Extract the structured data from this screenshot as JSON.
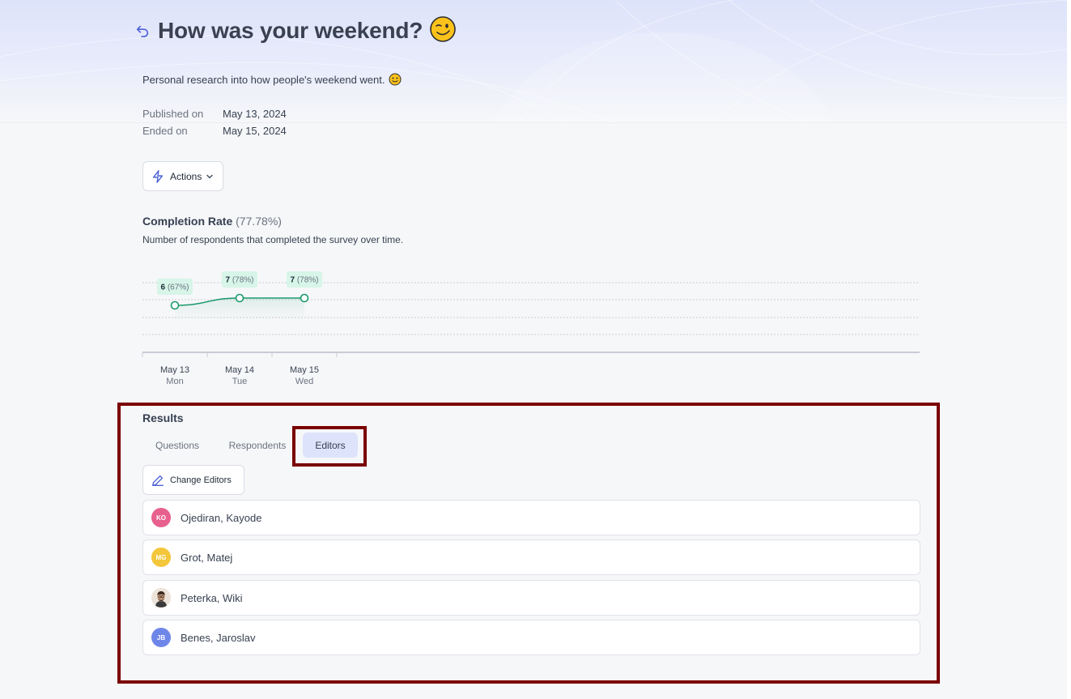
{
  "survey": {
    "title": "How was your weekend?",
    "description": "Personal research into how people's weekend went.",
    "published_label": "Published on",
    "published_value": "May 13, 2024",
    "ended_label": "Ended on",
    "ended_value": "May 15, 2024"
  },
  "actions": {
    "label": "Actions"
  },
  "completion": {
    "title": "Completion Rate",
    "rate": "(77.78%)",
    "subtitle": "Number of respondents that completed the survey over time."
  },
  "chart_data": {
    "type": "line",
    "categories": [
      "May 13",
      "May 14",
      "May 15"
    ],
    "weekdays": [
      "Mon",
      "Tue",
      "Wed"
    ],
    "values": [
      6,
      7,
      7
    ],
    "percent_labels": [
      "(67%)",
      "(78%)",
      "(78%)"
    ],
    "line_color": "#1a9a6a",
    "tooltip_bg": "#d7f5e8",
    "grid": "dashed"
  },
  "results": {
    "title": "Results",
    "tabs": [
      "Questions",
      "Respondents",
      "Editors"
    ],
    "active_tab": "Editors",
    "change_editors_label": "Change Editors",
    "editors": [
      {
        "name": "Ojediran, Kayode",
        "initials": "KO",
        "color": "#e8608d"
      },
      {
        "name": "Grot, Matej",
        "initials": "MG",
        "color": "#f3c63c"
      },
      {
        "name": "Peterka, Wiki",
        "initials": "",
        "color": "#e9d7c4",
        "avatar": "photo"
      },
      {
        "name": "Benes, Jaroslav",
        "initials": "JB",
        "color": "#6f86e9"
      }
    ]
  },
  "colors": {
    "accent": "#4f63d6",
    "highlight": "#7a0000",
    "active_tab_bg": "#dde3fb"
  }
}
